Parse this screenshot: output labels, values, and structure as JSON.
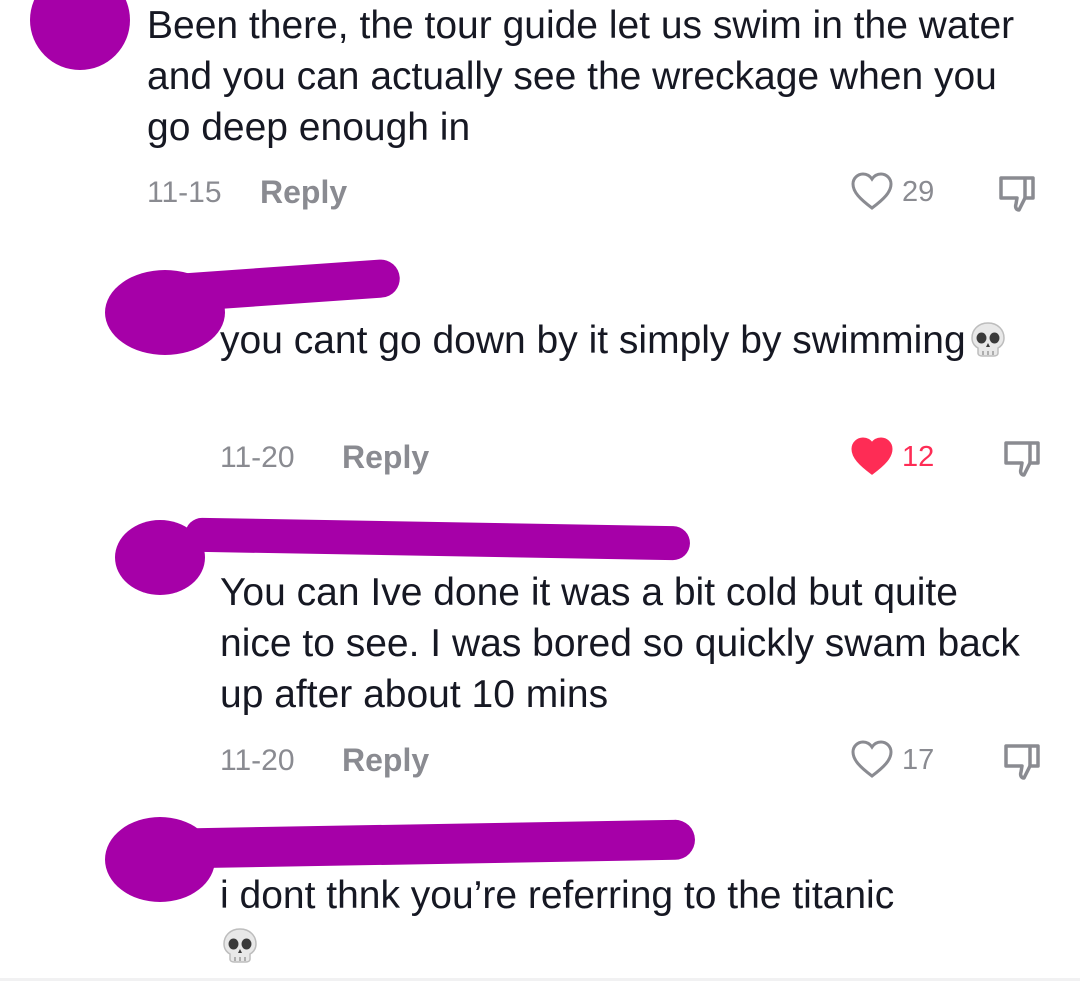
{
  "comments": [
    {
      "text": "Been there, the tour guide let us swim in the water and you can actually see the wreckage when you go deep enough in",
      "date": "11-15",
      "reply_label": "Reply",
      "likes": "29",
      "liked": false
    },
    {
      "text": "you cant go down by it simply by swimming",
      "emoji": "skull",
      "date": "11-20",
      "reply_label": "Reply",
      "likes": "12",
      "liked": true
    },
    {
      "text": "You can Ive done it was a bit cold but quite nice to see. I was bored so quickly swam back up after about 10 mins",
      "date": "11-20",
      "reply_label": "Reply",
      "likes": "17",
      "liked": false
    },
    {
      "text": "i dont thnk you’re referring to the titanic",
      "emoji": "skull",
      "liked": false
    }
  ],
  "colors": {
    "redaction": "#a600a8",
    "like_active": "#fe2c55",
    "meta_text": "#8a8b91"
  }
}
